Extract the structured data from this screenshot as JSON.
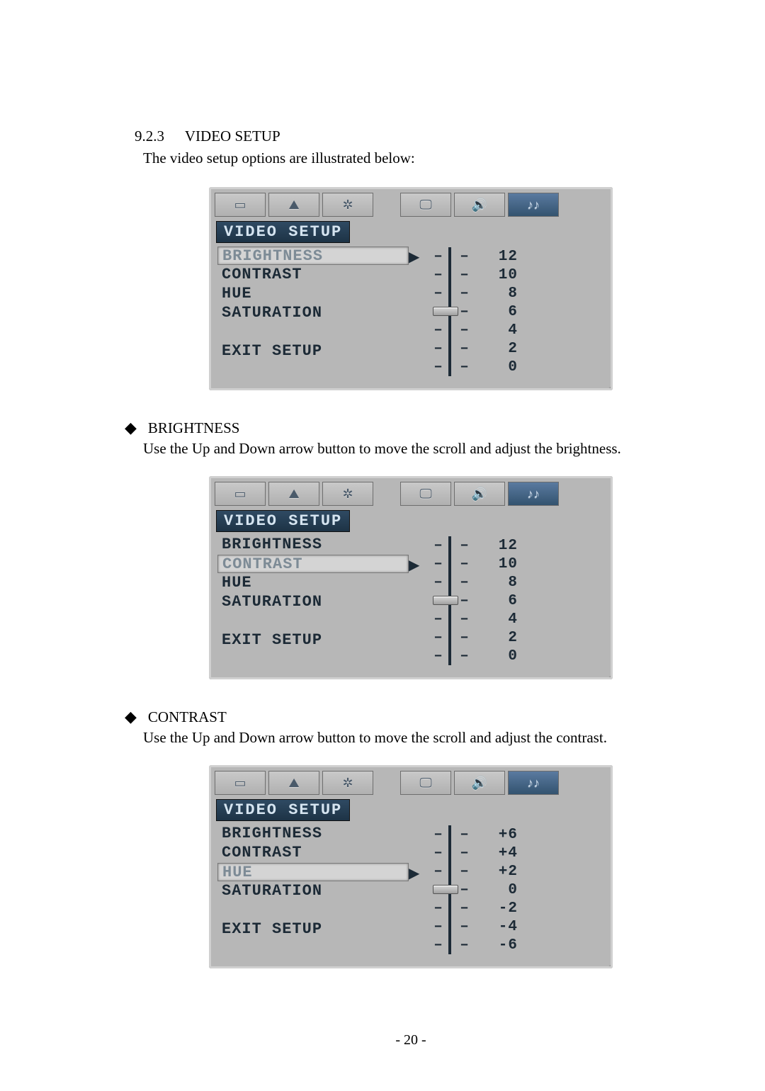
{
  "section": {
    "number": "9.2.3",
    "title": "VIDEO SETUP"
  },
  "intro": "The video setup options are illustrated below:",
  "bullets": [
    {
      "title": "BRIGHTNESS",
      "desc": "Use the Up and Down arrow button to move the scroll and adjust the brightness."
    },
    {
      "title": "CONTRAST",
      "desc": "Use the Up and Down arrow button to move the scroll and adjust the contrast."
    }
  ],
  "page_number": "- 20 -",
  "osd_common": {
    "title": "VIDEO SETUP",
    "menu_labels": {
      "brightness": "BRIGHTNESS",
      "contrast": "CONTRAST",
      "hue": "HUE",
      "saturation": "SATURATION",
      "exit": "EXIT SETUP"
    },
    "tab_icons": [
      "video-icon",
      "picture-icon",
      "settings-icon",
      "",
      "display-icon",
      "audio-icon",
      "equalizer-icon"
    ]
  },
  "panels": [
    {
      "selected": "brightness",
      "arrow_row": 0,
      "scale_values": [
        "12",
        "10",
        "8",
        "6",
        "4",
        "2",
        "0"
      ],
      "slider_row": 3
    },
    {
      "selected": "contrast",
      "arrow_row": 1,
      "scale_values": [
        "12",
        "10",
        "8",
        "6",
        "4",
        "2",
        "0"
      ],
      "slider_row": 3
    },
    {
      "selected": "hue",
      "arrow_row": 2,
      "scale_values": [
        "+6",
        "+4",
        "+2",
        "0",
        "-2",
        "-4",
        "-6"
      ],
      "slider_row": 3
    }
  ]
}
